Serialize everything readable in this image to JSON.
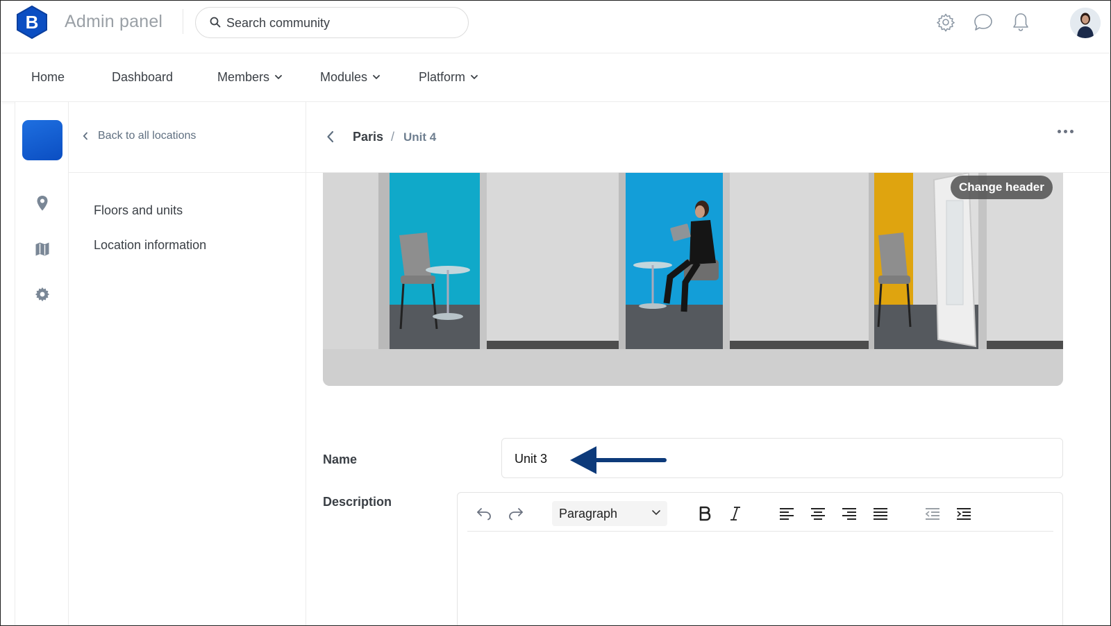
{
  "app": {
    "logo_letter": "B",
    "title": "Admin panel"
  },
  "search": {
    "placeholder": "Search community"
  },
  "top_icons": [
    "gear-icon",
    "chat-icon",
    "bell-icon",
    "avatar"
  ],
  "nav": {
    "items": [
      {
        "label": "Home",
        "dropdown": false
      },
      {
        "label": "Dashboard",
        "dropdown": false
      },
      {
        "label": "Members",
        "dropdown": true
      },
      {
        "label": "Modules",
        "dropdown": true
      },
      {
        "label": "Platform",
        "dropdown": true
      }
    ]
  },
  "rail": {
    "icons": [
      "map-pin-icon",
      "map-icon",
      "gear-icon"
    ]
  },
  "subside": {
    "back_label": "Back to all locations",
    "items": [
      {
        "label": "Floors and units"
      },
      {
        "label": "Location information"
      }
    ]
  },
  "breadcrumb": {
    "parent": "Paris",
    "separator": "/",
    "current": "Unit 4"
  },
  "header": {
    "change_label": "Change header"
  },
  "form": {
    "name_label": "Name",
    "name_value": "Unit 3",
    "description_label": "Description",
    "block_format": "Paragraph",
    "toolbar_icons": [
      "undo-icon",
      "redo-icon",
      "bold-icon",
      "italic-icon",
      "align-left-icon",
      "align-center-icon",
      "align-right-icon",
      "align-justify-icon",
      "outdent-icon",
      "indent-icon"
    ]
  },
  "colors": {
    "brand": "#0b4ec2",
    "arrow": "#0d3a7a",
    "text": "#3a3f45"
  }
}
